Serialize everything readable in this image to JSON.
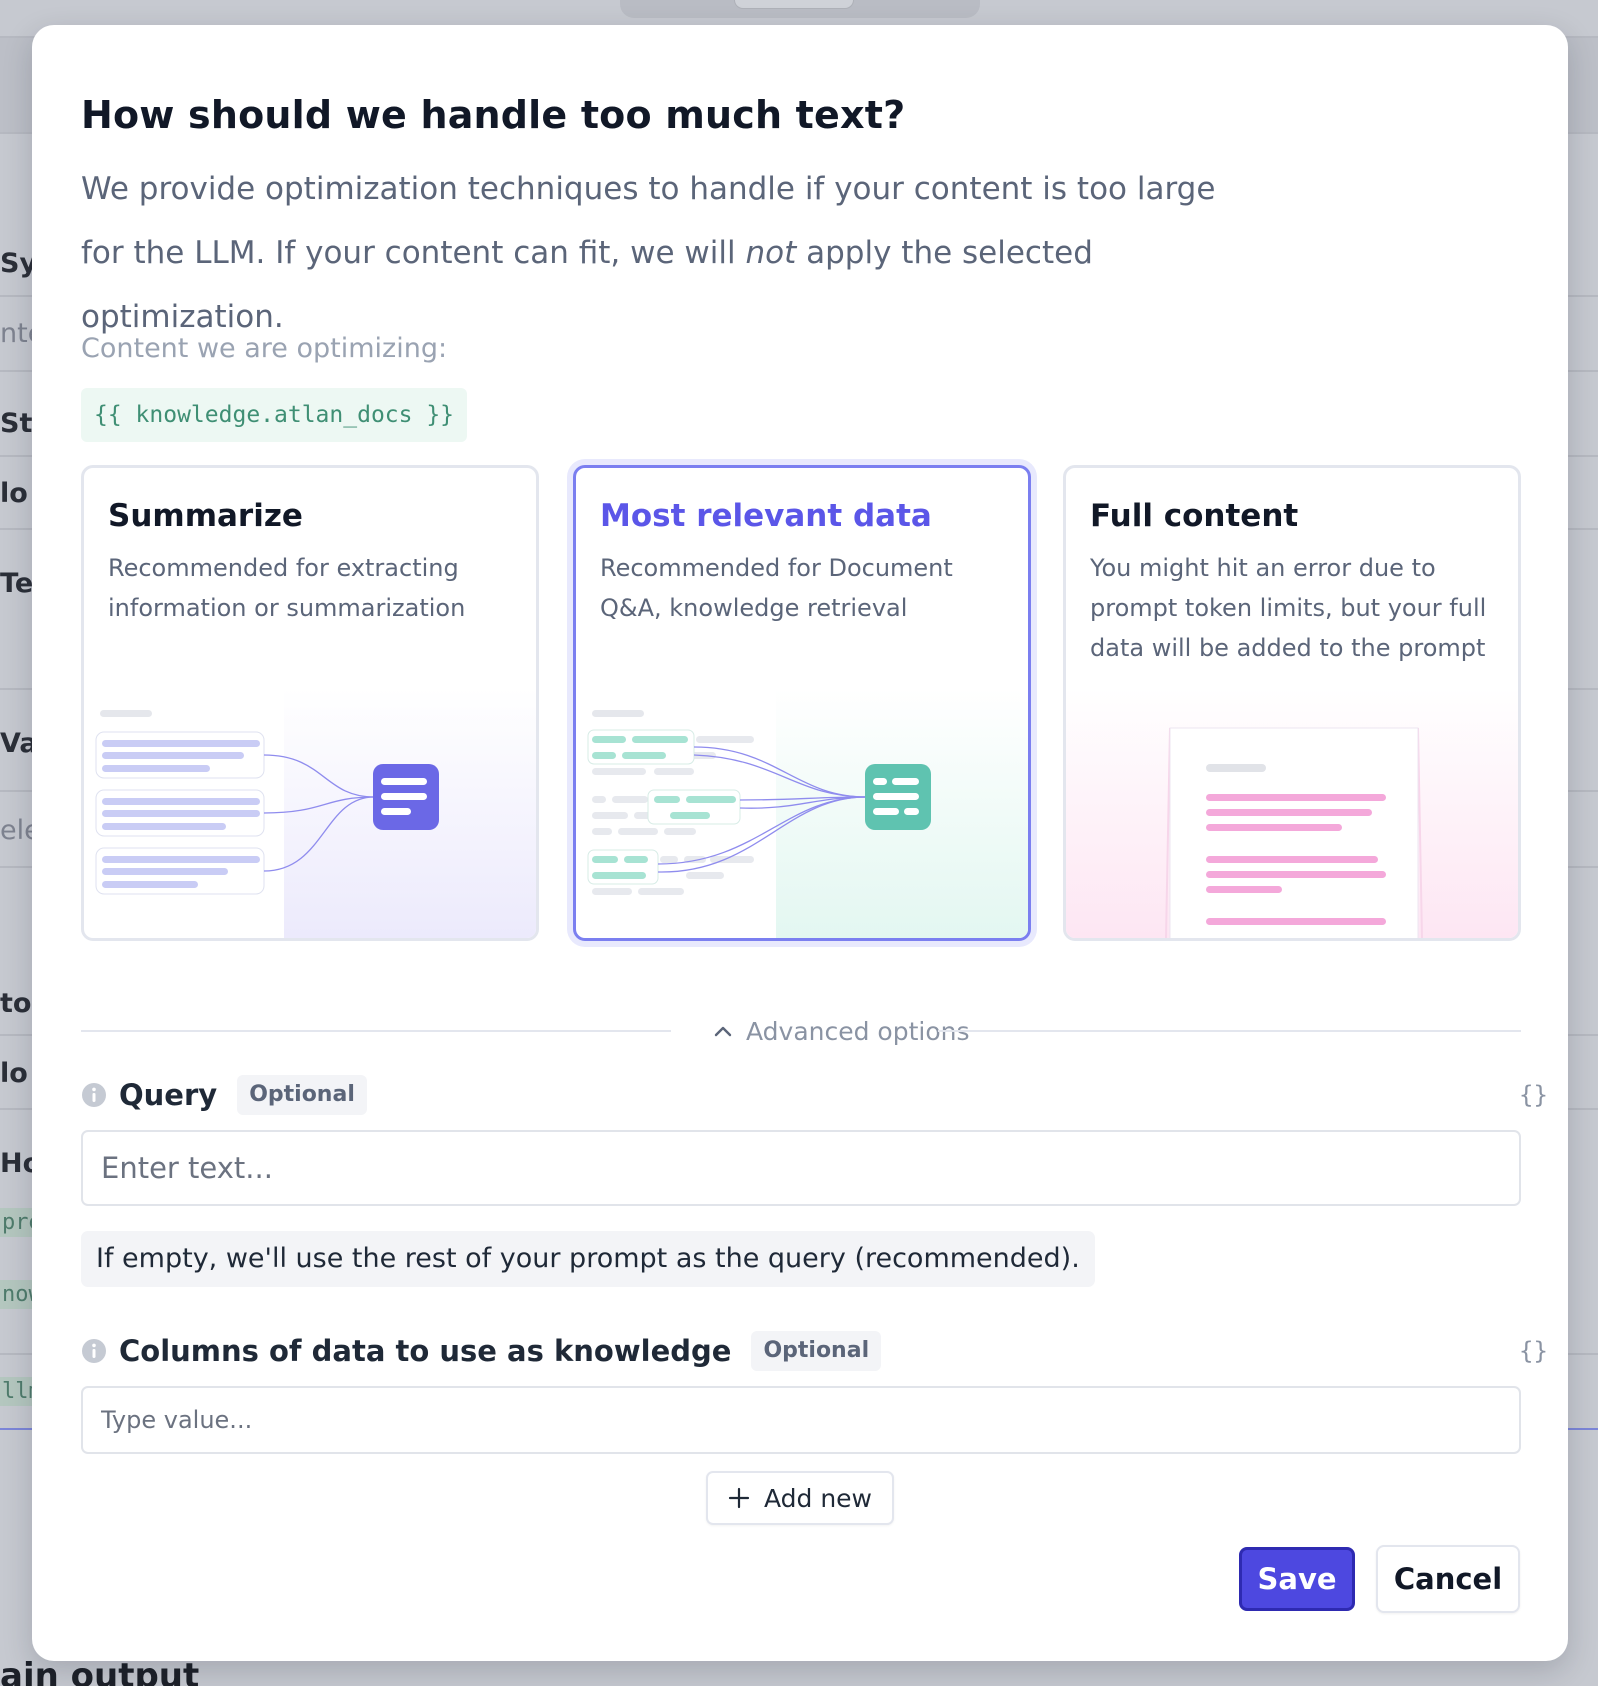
{
  "background": {
    "edge_labels": [
      "Sy",
      "nte",
      "St",
      "lo",
      "Te",
      "Va",
      "ele",
      "to",
      "lo",
      "Ho"
    ],
    "edge_codes": [
      "pre",
      "now",
      "llm"
    ],
    "bottom_title": "ain output"
  },
  "modal": {
    "title": "How should we handle too much text?",
    "description_part1": "We provide optimization techniques to handle if your content is too large for the LLM. If your content can fit, we will ",
    "description_em": "not",
    "description_part2": " apply the selected optimization.",
    "content_label": "Content we are optimizing:",
    "content_variable": "{{ knowledge.atlan_docs }}"
  },
  "options": [
    {
      "title": "Summarize",
      "description": "Recommended for extracting information or summarization",
      "selected": false
    },
    {
      "title": "Most relevant data",
      "description": "Recommended for Document Q&A, knowledge retrieval",
      "selected": true
    },
    {
      "title": "Full content",
      "description": "You might hit an error due to prompt token limits, but your full data will be added to the prompt",
      "selected": false
    }
  ],
  "advanced": {
    "toggle_label": "Advanced options",
    "toggle_icon": "chevron-up-icon",
    "query": {
      "label": "Query",
      "badge": "Optional",
      "braces": "{}",
      "placeholder": "Enter text...",
      "hint": "If empty, we'll use the rest of your prompt as the query (recommended)."
    },
    "columns": {
      "label": "Columns of data to use as knowledge",
      "badge": "Optional",
      "braces": "{}",
      "placeholder": "Type value..."
    },
    "add_new_label": "Add new"
  },
  "actions": {
    "save_label": "Save",
    "cancel_label": "Cancel"
  },
  "colors": {
    "accent": "#4d48e0",
    "selected_border": "#7b7ff0",
    "summarize_art": "#6c6ce8",
    "relevant_art": "#5fc9b4",
    "full_art": "#f2a6d9"
  }
}
